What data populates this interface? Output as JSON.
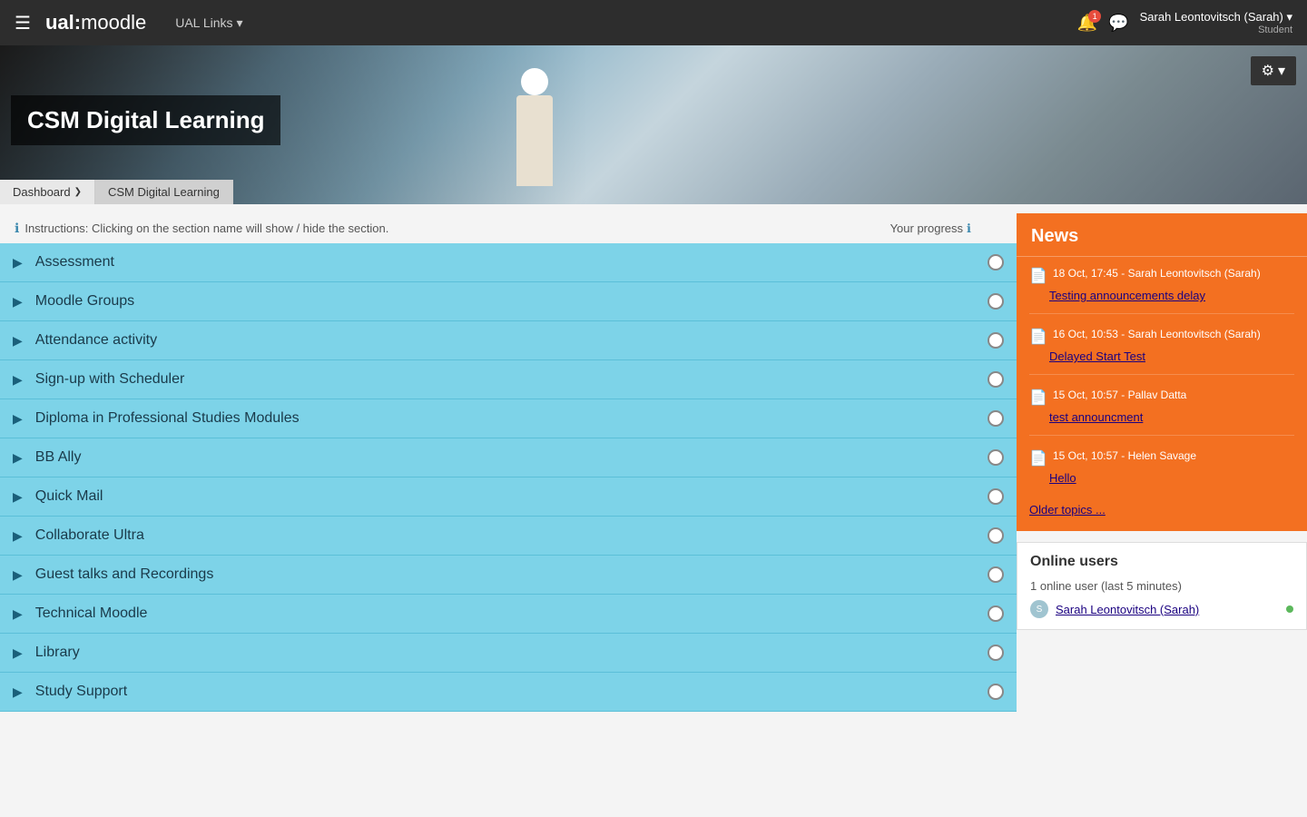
{
  "topnav": {
    "logo_ual": "ual:",
    "logo_moodle": " moodle",
    "ual_links": "UAL Links",
    "ual_links_arrow": "▾",
    "notif_count": "1",
    "user_name": "Sarah Leontovitsch (Sarah) ▾",
    "user_role": "Student"
  },
  "hero": {
    "title": "CSM Digital Learning",
    "gear_icon": "⚙",
    "gear_arrow": "▾"
  },
  "breadcrumbs": [
    {
      "label": "Dashboard",
      "arrow": "❯",
      "id": "dashboard"
    },
    {
      "label": "CSM Digital Learning",
      "id": "csm"
    }
  ],
  "instructions": "Instructions: Clicking on the section name will show / hide the section.",
  "progress_label": "Your progress",
  "sections": [
    {
      "label": "Assessment"
    },
    {
      "label": "Moodle Groups"
    },
    {
      "label": "Attendance activity"
    },
    {
      "label": "Sign-up with Scheduler"
    },
    {
      "label": "Diploma in Professional Studies Modules"
    },
    {
      "label": "BB Ally"
    },
    {
      "label": "Quick Mail"
    },
    {
      "label": "Collaborate Ultra"
    },
    {
      "label": "Guest talks and Recordings"
    },
    {
      "label": "Technical Moodle"
    },
    {
      "label": "Library"
    },
    {
      "label": "Study Support"
    }
  ],
  "news": {
    "header": "News",
    "entries": [
      {
        "meta": "18 Oct, 17:45  -  Sarah Leontovitsch (Sarah)",
        "link": "Testing announcements delay"
      },
      {
        "meta": "16 Oct, 10:53  -  Sarah Leontovitsch (Sarah)",
        "link": "Delayed Start Test"
      },
      {
        "meta": "15 Oct, 10:57  -  Pallav Datta",
        "link": "test announcment"
      },
      {
        "meta": "15 Oct, 10:57  -  Helen Savage",
        "link": "Hello"
      }
    ],
    "older_topics": "Older topics ..."
  },
  "online_users": {
    "header": "Online users",
    "count": "1 online user (last 5 minutes)",
    "users": [
      {
        "name": "Sarah Leontovitsch (Sarah)"
      }
    ]
  }
}
